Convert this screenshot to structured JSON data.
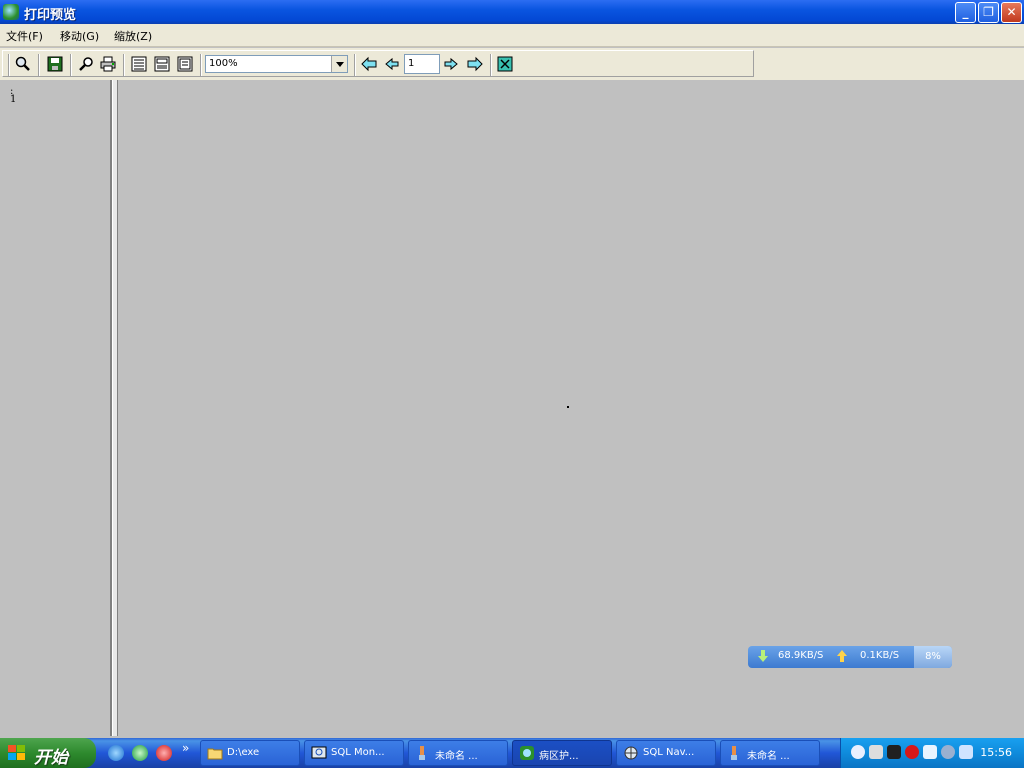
{
  "window": {
    "title": "打印预览",
    "minimize": "_",
    "restore": "❐",
    "close": "✕"
  },
  "menu": [
    {
      "label": "文件(F)"
    },
    {
      "label": "移动(G)"
    },
    {
      "label": "缩放(Z)"
    }
  ],
  "toolbar": {
    "zoom_value": "100%",
    "page_value": "1",
    "icons": [
      "zoom-icon",
      "save-icon",
      "find-icon",
      "print-icon",
      "page-width-icon",
      "page-full-icon",
      "page-two-icon",
      "first-page-icon",
      "prev-page-icon",
      "next-page-icon",
      "last-page-icon",
      "exit-icon"
    ]
  },
  "left_panel": {
    "colon": ":",
    "page_number": "1"
  },
  "net_monitor": {
    "down": "68.9KB/S",
    "up": "0.1KB/S",
    "percent": "8%"
  },
  "taskbar": {
    "start_label": "开始",
    "more": "»",
    "tasks": [
      {
        "label": "D:\\exe"
      },
      {
        "label": "SQL Mon..."
      },
      {
        "label": "未命名 ..."
      },
      {
        "label": "病区护..."
      },
      {
        "label": "SQL Nav..."
      },
      {
        "label": "未命名 ..."
      }
    ],
    "clock": "15:56"
  },
  "colors": {
    "title_blue": "#0a55e0",
    "taskbar_blue": "#2157d7",
    "start_green": "#2e8a2e",
    "preview_bg": "#c0c0c0"
  }
}
